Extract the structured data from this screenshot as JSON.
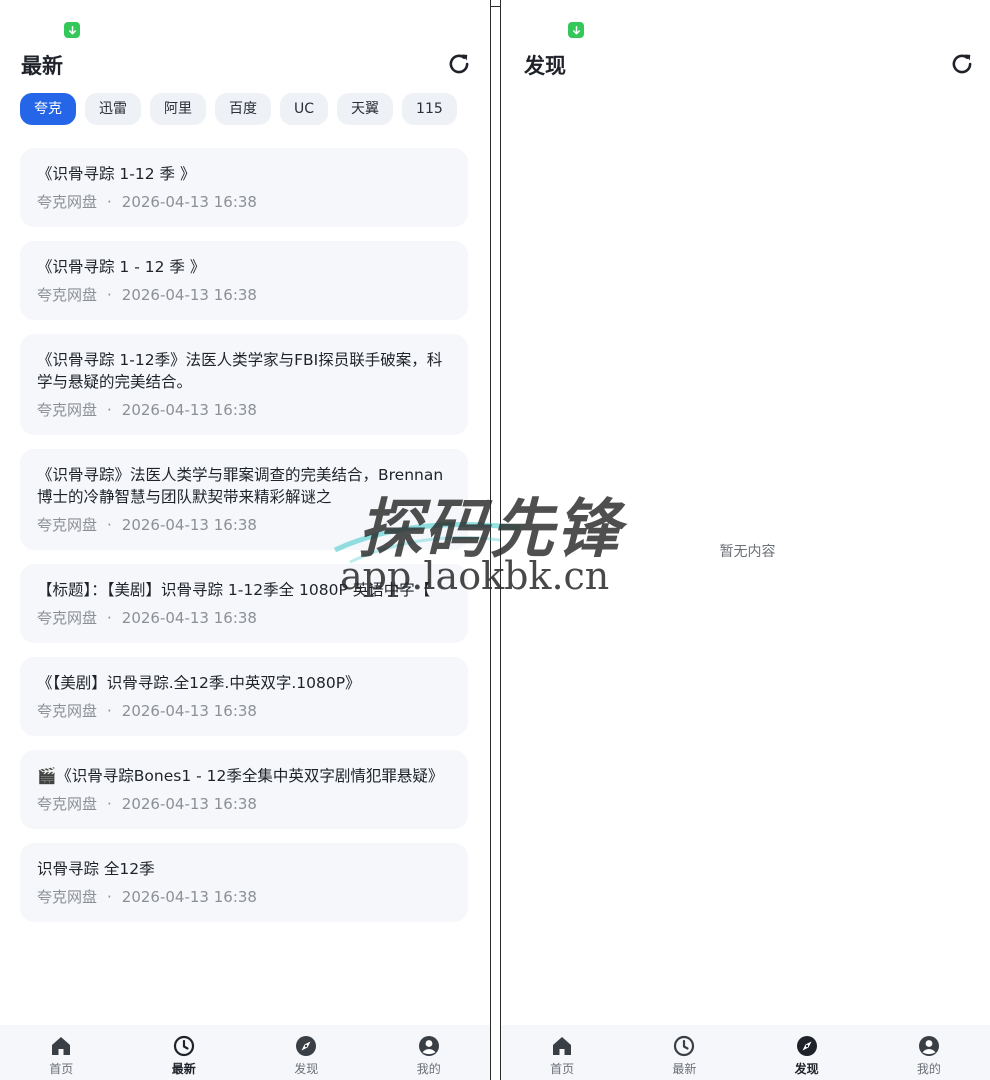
{
  "left": {
    "title": "最新",
    "chips": [
      "夸克",
      "迅雷",
      "阿里",
      "百度",
      "UC",
      "天翼",
      "115"
    ],
    "active_chip": 0,
    "items": [
      {
        "title": "《识骨寻踪 1-12 季 》",
        "source": "夸克网盘",
        "date": "2026-04-13 16:38"
      },
      {
        "title": "《识骨寻踪 1 - 12 季 》",
        "source": "夸克网盘",
        "date": "2026-04-13 16:38"
      },
      {
        "title": "《识骨寻踪 1-12季》法医人类学家与FBI探员联手破案，科学与悬疑的完美结合。",
        "source": "夸克网盘",
        "date": "2026-04-13 16:38"
      },
      {
        "title": "《识骨寻踪》法医人类学与罪案调查的完美结合，Brennan博士的冷静智慧与团队默契带来精彩解谜之",
        "source": "夸克网盘",
        "date": "2026-04-13 16:38"
      },
      {
        "title": "【标题】：【美剧】识骨寻踪 1-12季全 1080P 英语中字【",
        "source": "夸克网盘",
        "date": "2026-04-13 16:38"
      },
      {
        "title": "《【美剧】识骨寻踪.全12季.中英双字.1080P》",
        "source": "夸克网盘",
        "date": "2026-04-13 16:38"
      },
      {
        "title": "🎬《识骨寻踪Bones1 - 12季全集中英双字剧情犯罪悬疑》",
        "source": "夸克网盘",
        "date": "2026-04-13 16:38"
      },
      {
        "title": "识骨寻踪   全12季",
        "source": "夸克网盘",
        "date": "2026-04-13 16:38"
      }
    ],
    "active_tab": 1
  },
  "right": {
    "title": "发现",
    "empty_text": "暂无内容",
    "active_tab": 2
  },
  "tabs": [
    {
      "label": "首页",
      "icon": "home-icon"
    },
    {
      "label": "最新",
      "icon": "clock-icon"
    },
    {
      "label": "发现",
      "icon": "compass-icon"
    },
    {
      "label": "我的",
      "icon": "user-icon"
    }
  ],
  "watermark": {
    "name": "探码先锋",
    "url": "app.laokbk.cn"
  },
  "colors": {
    "accent": "#2566e8",
    "card_bg": "#f5f7fa",
    "chip_bg": "#eef1f6",
    "status_green": "#34c759"
  }
}
